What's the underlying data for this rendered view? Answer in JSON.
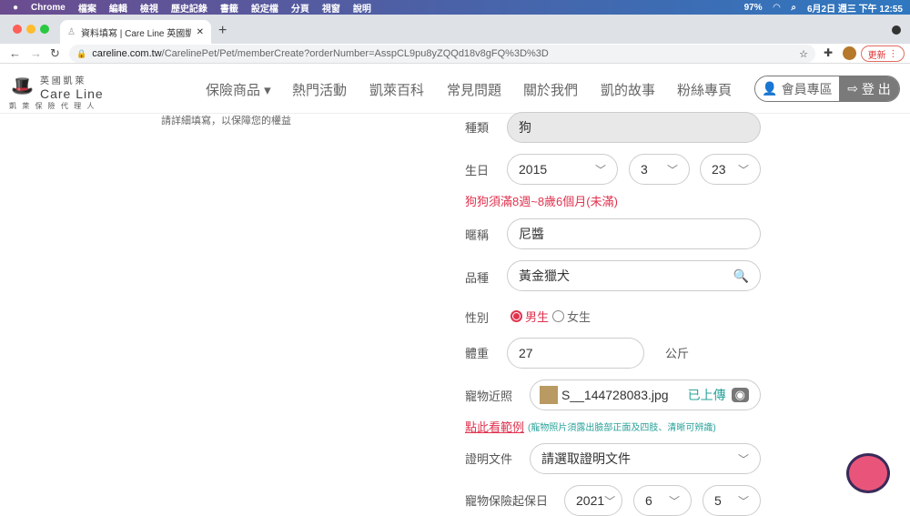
{
  "mac": {
    "app": "Chrome",
    "menus": [
      "檔案",
      "編輯",
      "檢視",
      "歷史記錄",
      "書籤",
      "設定檔",
      "分頁",
      "視窗",
      "說明"
    ],
    "battery": "97%",
    "datetime": "6月2日 週三 下午 12:55"
  },
  "browser": {
    "tab_title": "資料填寫 | Care Line 英國凱萊 ",
    "url_host": "careline.com.tw",
    "url_path": "/CarelinePet/Pet/memberCreate?orderNumber=AsspCL9pu8yZQQd18v8gFQ%3D%3D",
    "update": "更新"
  },
  "logo": {
    "top": "英 國 凱 萊",
    "main": "Care Line",
    "sub": "凱 萊 保 險 代 理 人"
  },
  "nav": [
    "保險商品",
    "熱門活動",
    "凱萊百科",
    "常見問題",
    "關於我們",
    "凱的故事",
    "粉絲專頁"
  ],
  "member": "會員專區",
  "logout": "登 出",
  "hint": "請詳細填寫，以保障您的權益",
  "form": {
    "species_label": "種類",
    "species": "狗",
    "birth_label": "生日",
    "birth_year": "2015",
    "birth_month": "3",
    "birth_day": "23",
    "age_warning": "狗狗須滿8週~8歲6個月(未滿)",
    "name_label": "暱稱",
    "name": "尼醬",
    "breed_label": "品種",
    "breed": "黃金獵犬",
    "gender_label": "性別",
    "male": "男生",
    "female": "女生",
    "weight_label": "體重",
    "weight": "27",
    "weight_unit": "公斤",
    "photo_label": "寵物近照",
    "photo_file": "S__144728083.jpg",
    "photo_status": "已上傳",
    "example_link": "點此看範例",
    "photo_note": "(寵物照片須露出臉部正面及四肢、清晰可辨識)",
    "doc_label": "證明文件",
    "doc_placeholder": "請選取證明文件",
    "start_label": "寵物保險起保日",
    "start_year": "2021",
    "start_month": "6",
    "start_day": "5"
  }
}
